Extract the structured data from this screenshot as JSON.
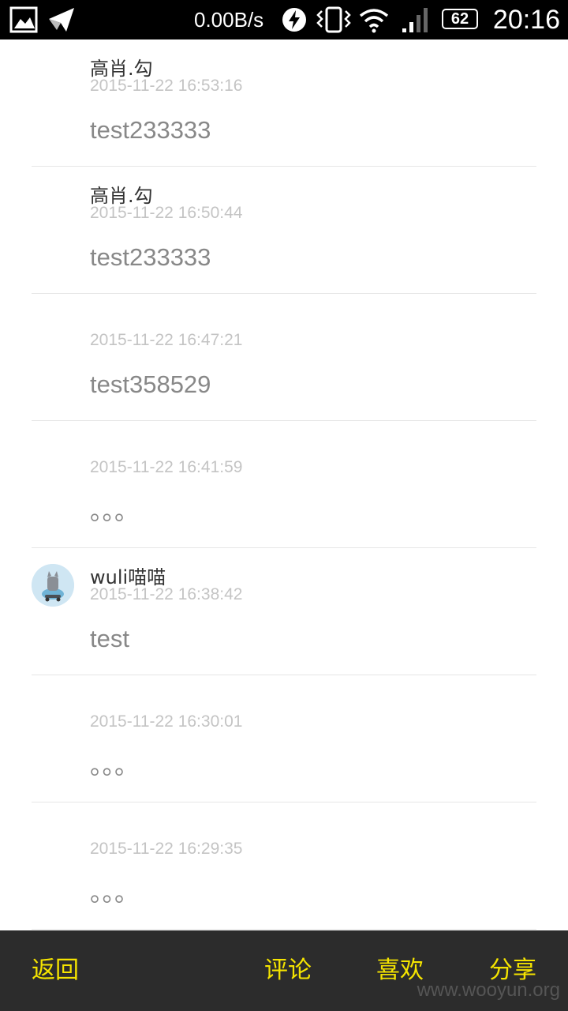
{
  "status_bar": {
    "net_speed": "0.00B/s",
    "battery": "62",
    "time": "20:16",
    "icons": [
      "gallery-icon",
      "send-icon",
      "bolt-icon",
      "vibrate-icon",
      "wifi-icon",
      "signal-icon",
      "battery-icon"
    ]
  },
  "comments": [
    {
      "username": "高肖.勾",
      "timestamp": "2015-11-22 16:53:16",
      "content": "test233333"
    },
    {
      "username": "高肖.勾",
      "timestamp": "2015-11-22 16:50:44",
      "content": "test233333"
    },
    {
      "username": "",
      "timestamp": "2015-11-22 16:47:21",
      "content": "test358529"
    },
    {
      "username": "",
      "timestamp": "2015-11-22 16:41:59",
      "content": "。。。"
    },
    {
      "username": "wuli喵喵",
      "timestamp": "2015-11-22 16:38:42",
      "content": "test"
    },
    {
      "username": "",
      "timestamp": "2015-11-22 16:30:01",
      "content": "。。。"
    },
    {
      "username": "",
      "timestamp": "2015-11-22 16:29:35",
      "content": "。。。"
    }
  ],
  "bottom_bar": {
    "back": "返回",
    "comment": "评论",
    "like": "喜欢",
    "share": "分享"
  },
  "watermark": "www.wooyun.org",
  "colors": {
    "action_text": "#f5e400",
    "bottom_bar_bg": "#2c2c2c",
    "timestamp": "#c4c4c4",
    "content": "#888888"
  }
}
